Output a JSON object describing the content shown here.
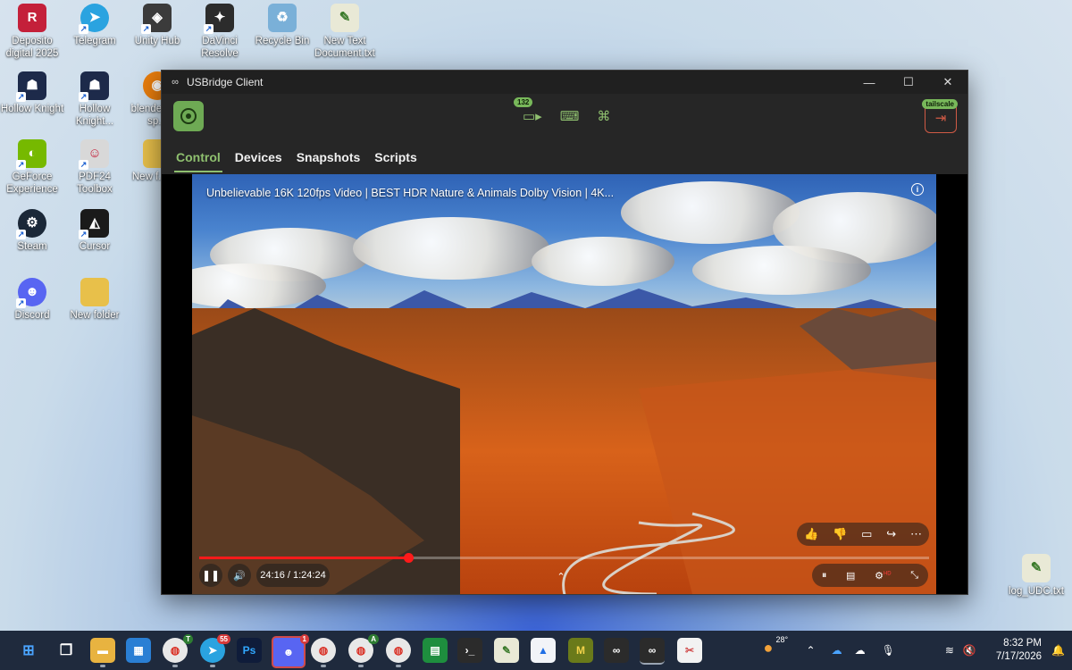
{
  "desktop": {
    "icons": [
      {
        "label": "Deposito digital 2025",
        "icon": "deposito-icon",
        "color": "#c4203a"
      },
      {
        "label": "Telegram",
        "icon": "telegram-icon",
        "color": "#2aa3e0"
      },
      {
        "label": "Unity Hub",
        "icon": "unity-hub-icon",
        "color": "#3b3b3b"
      },
      {
        "label": "DaVinci Resolve",
        "icon": "davinci-icon",
        "color": "#2c2c2c"
      },
      {
        "label": "Recycle Bin",
        "icon": "recycle-bin-icon",
        "color": "#7ab0d8"
      },
      {
        "label": "New Text Document.txt",
        "icon": "text-file-icon",
        "color": "#6ba34e"
      },
      {
        "label": "Hollow Knight",
        "icon": "hollow-knight-icon",
        "color": "#1d2a4a"
      },
      {
        "label": "Hollow Knight...",
        "icon": "hollow-knight-icon",
        "color": "#1d2a4a"
      },
      {
        "label": "blende... — sp...",
        "icon": "blender-icon",
        "color": "#e87d0d"
      },
      {
        "label": "GeForce Experience",
        "icon": "geforce-icon",
        "color": "#76b900"
      },
      {
        "label": "PDF24 Toolbox",
        "icon": "pdf24-icon",
        "color": "#d8d8d8"
      },
      {
        "label": "New f... (3)",
        "icon": "folder-icon",
        "color": "#e8c04a"
      },
      {
        "label": "Steam",
        "icon": "steam-icon",
        "color": "#1b2838"
      },
      {
        "label": "Cursor",
        "icon": "cursor-icon",
        "color": "#1a1a1a"
      },
      {
        "label": "Discord",
        "icon": "discord-icon",
        "color": "#5865f2"
      },
      {
        "label": "New folder",
        "icon": "folder-icon",
        "color": "#e8c04a"
      },
      {
        "label": "log_UDC.txt",
        "icon": "text-file-icon",
        "color": "#6ba34e"
      }
    ]
  },
  "window": {
    "title": "USBridge Client",
    "toolbar": {
      "camera_badge": "132",
      "exit_tag": "tailscale",
      "accent": "#8fc06f"
    },
    "tabs": [
      {
        "label": "Control",
        "active": true
      },
      {
        "label": "Devices",
        "active": false
      },
      {
        "label": "Snapshots",
        "active": false
      },
      {
        "label": "Scripts",
        "active": false
      }
    ]
  },
  "video": {
    "title": "Unbelievable 16K 120fps Video | BEST HDR Nature & Animals Dolby Vision | 4K...",
    "time": "24:16 / 1:24:24",
    "progress": 0.287,
    "hd_badge": "HD"
  },
  "taskbar": {
    "weather_temp": "28°",
    "time": "8:32 PM",
    "date": "7/17/2026",
    "discord_badge": "1",
    "telegram_badge": "55",
    "chrome_badge_t": "T",
    "chrome_badge_a": "A"
  }
}
